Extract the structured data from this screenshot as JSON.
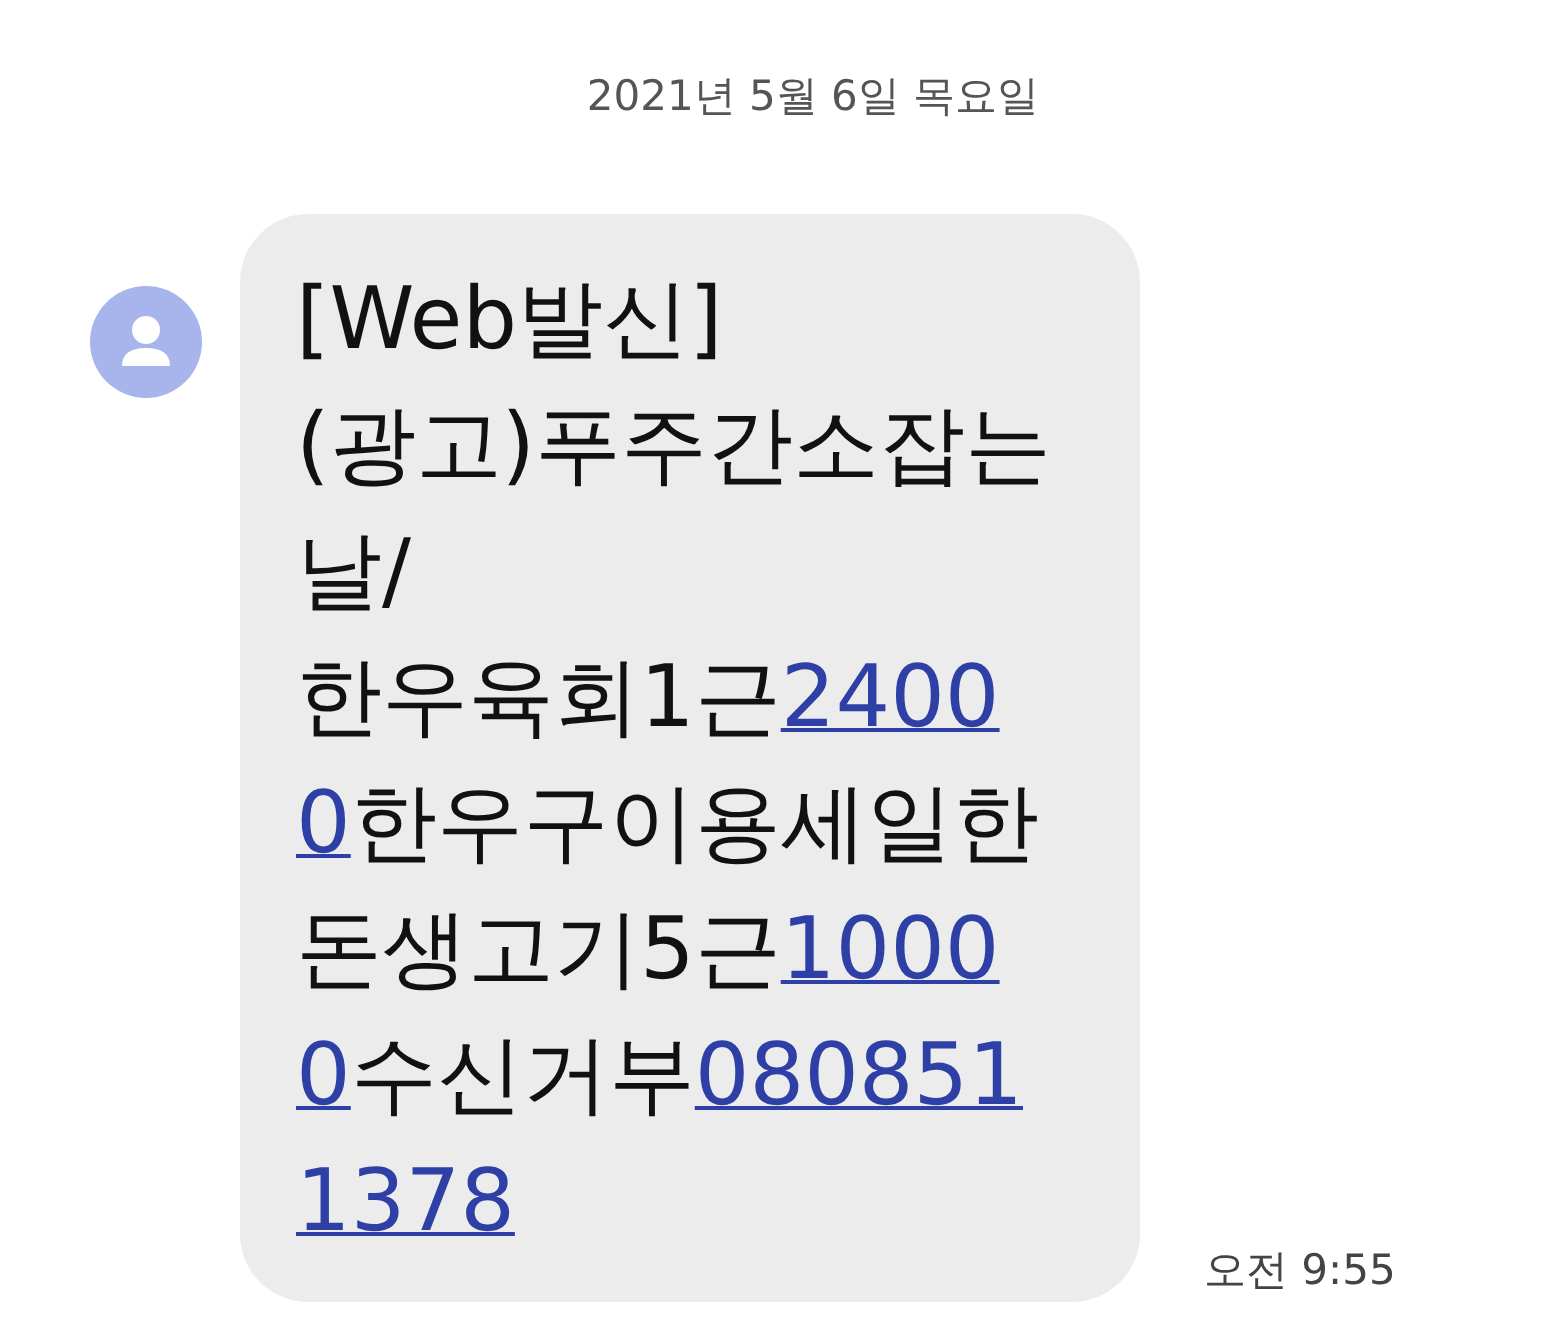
{
  "date_header": "2021년 5월 6일 목요일",
  "message": {
    "lines": [
      [
        {
          "kind": "text",
          "text": "[Web발신]"
        }
      ],
      [
        {
          "kind": "text",
          "text": "(광고)푸주간소잡는"
        }
      ],
      [
        {
          "kind": "text",
          "text": "날/"
        }
      ],
      [
        {
          "kind": "text",
          "text": "한우육회1근"
        },
        {
          "kind": "link",
          "text": "2400"
        }
      ],
      [
        {
          "kind": "link",
          "text": "0"
        },
        {
          "kind": "text",
          "text": "한우구이용세일한"
        }
      ],
      [
        {
          "kind": "text",
          "text": "돈생고기5근"
        },
        {
          "kind": "link",
          "text": "1000"
        }
      ],
      [
        {
          "kind": "link",
          "text": "0"
        },
        {
          "kind": "text",
          "text": "수신거부"
        },
        {
          "kind": "link",
          "text": "080851"
        }
      ],
      [
        {
          "kind": "link",
          "text": "1378"
        }
      ]
    ],
    "time": "오전 9:55"
  }
}
